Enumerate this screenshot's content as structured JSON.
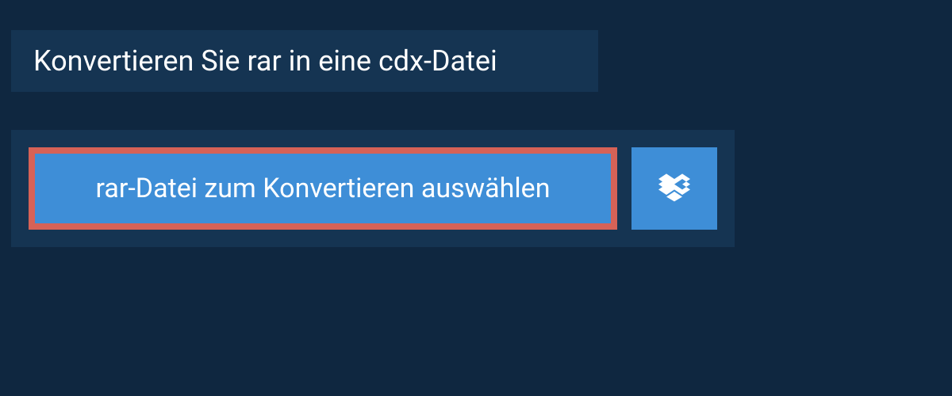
{
  "header": {
    "title": "Konvertieren Sie rar in eine cdx-Datei"
  },
  "actions": {
    "select_file_label": "rar-Datei zum Konvertieren auswählen"
  }
}
